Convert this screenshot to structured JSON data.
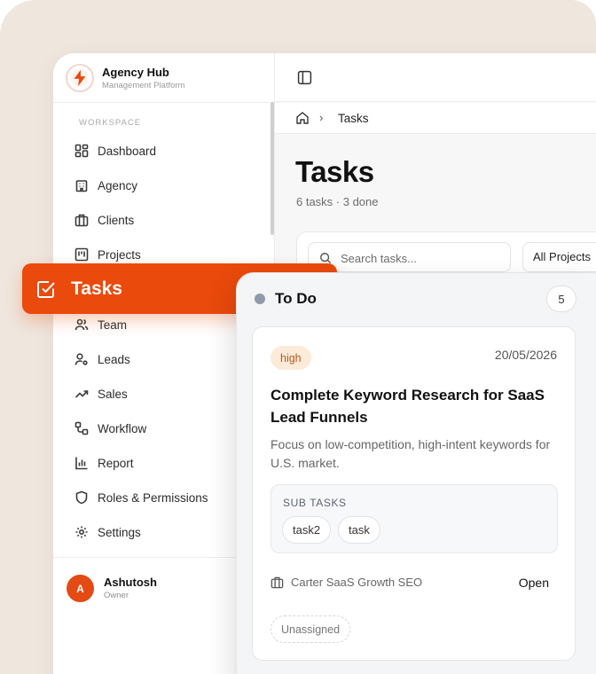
{
  "brand": {
    "name": "Agency Hub",
    "subtitle": "Management Platform",
    "accent": "#ea4a0c"
  },
  "sidebar": {
    "section_label": "WORKSPACE",
    "items": [
      {
        "label": "Dashboard",
        "icon": "dashboard-icon"
      },
      {
        "label": "Agency",
        "icon": "building-icon"
      },
      {
        "label": "Clients",
        "icon": "briefcase-icon"
      },
      {
        "label": "Projects",
        "icon": "kanban-icon"
      },
      {
        "label": "Tasks",
        "icon": "checkbox-icon",
        "active": true
      },
      {
        "label": "Team",
        "icon": "users-icon"
      },
      {
        "label": "Leads",
        "icon": "user-cog-icon"
      },
      {
        "label": "Sales",
        "icon": "trending-up-icon"
      },
      {
        "label": "Workflow",
        "icon": "workflow-icon"
      },
      {
        "label": "Report",
        "icon": "bar-chart-icon"
      },
      {
        "label": "Roles & Permissions",
        "icon": "shield-icon"
      },
      {
        "label": "Settings",
        "icon": "gear-icon"
      }
    ],
    "user": {
      "initial": "A",
      "name": "Ashutosh",
      "role": "Owner"
    }
  },
  "breadcrumb": {
    "current": "Tasks"
  },
  "page": {
    "title": "Tasks",
    "subtitle": "6 tasks · 3 done"
  },
  "filters": {
    "search_placeholder": "Search tasks...",
    "project_filter": "All Projects"
  },
  "column": {
    "title": "To Do",
    "count": "5",
    "dot_color": "#8f9aab"
  },
  "card": {
    "priority": "high",
    "due_date": "20/05/2026",
    "title": "Complete Keyword Research for SaaS Lead Funnels",
    "description": "Focus on low-competition, high-intent keywords for U.S. market.",
    "subtasks_label": "SUB TASKS",
    "subtasks": [
      "task2",
      "task"
    ],
    "client": "Carter SaaS Growth SEO",
    "status": "Open",
    "assignee": "Unassigned"
  }
}
